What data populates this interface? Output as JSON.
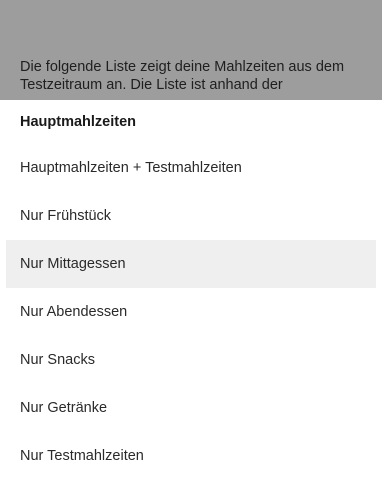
{
  "background_info": {
    "text": "Die folgende Liste zeigt deine Mahlzeiten aus dem Testzeitraum an. Die Liste ist anhand der"
  },
  "filter_menu": {
    "options": [
      {
        "label": "Hauptmahlzeiten",
        "selected": true
      },
      {
        "label": "Hauptmahlzeiten + Testmahlzeiten",
        "selected": false
      },
      {
        "label": "Nur Frühstück",
        "selected": false
      },
      {
        "label": "Nur Mittagessen",
        "selected": false,
        "highlighted": true
      },
      {
        "label": "Nur Abendessen",
        "selected": false
      },
      {
        "label": "Nur Snacks",
        "selected": false
      },
      {
        "label": "Nur Getränke",
        "selected": false
      },
      {
        "label": "Nur Testmahlzeiten",
        "selected": false
      }
    ]
  },
  "colors": {
    "backdrop": "#9d9d9d",
    "sheet": "#ffffff",
    "highlight": "#efefef"
  }
}
